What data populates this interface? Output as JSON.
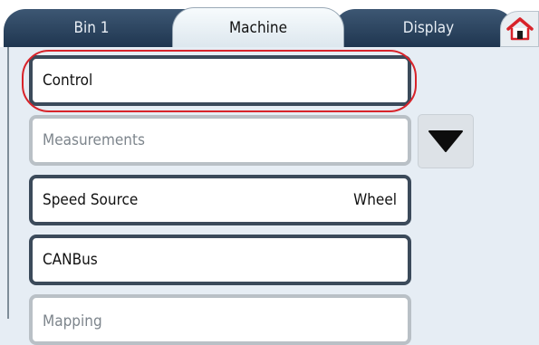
{
  "tabs": [
    {
      "label": "Bin 1",
      "active": false
    },
    {
      "label": "Machine",
      "active": true
    },
    {
      "label": "Display",
      "active": false
    }
  ],
  "home": {
    "icon": "home-icon",
    "color": "#d8232a"
  },
  "menu": {
    "items": [
      {
        "label": "Control",
        "value": "",
        "enabled": true,
        "highlighted": true
      },
      {
        "label": "Measurements",
        "value": "",
        "enabled": false
      },
      {
        "label": "Speed Source",
        "value": "Wheel",
        "enabled": true
      },
      {
        "label": "CANBus",
        "value": "",
        "enabled": true
      },
      {
        "label": "Mapping",
        "value": "",
        "enabled": false
      }
    ]
  },
  "scroll": {
    "icon": "triangle-down-icon"
  },
  "colors": {
    "highlight": "#d8232a",
    "tab_dark": "#2b4560",
    "background": "#e6edf4"
  }
}
